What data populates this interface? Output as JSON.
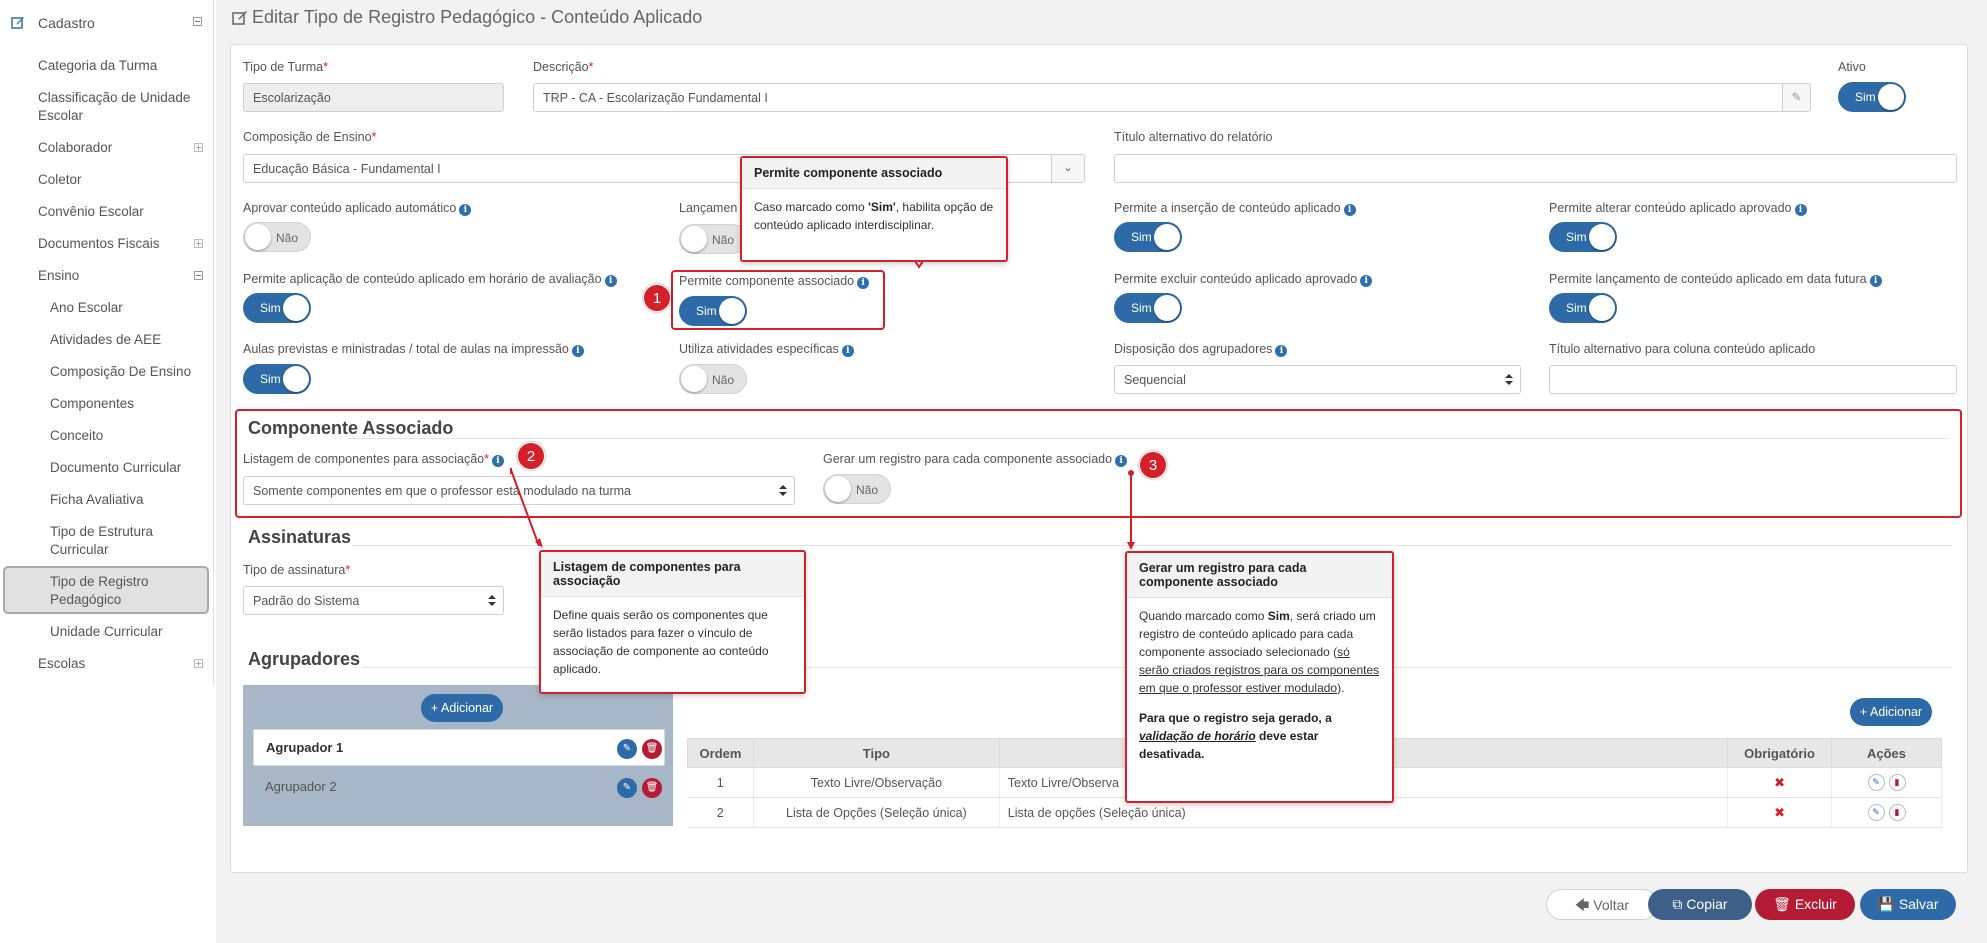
{
  "sidebar": {
    "header": "Cadastro",
    "items": [
      {
        "label": "Categoria da Turma"
      },
      {
        "label": "Classificação de Unidade Escolar"
      },
      {
        "label": "Colaborador"
      },
      {
        "label": "Coletor"
      },
      {
        "label": "Convênio Escolar"
      },
      {
        "label": "Documentos Fiscais"
      },
      {
        "label": "Ensino"
      },
      {
        "label": "Ano Escolar"
      },
      {
        "label": "Atividades de AEE"
      },
      {
        "label": "Composição De Ensino"
      },
      {
        "label": "Componentes"
      },
      {
        "label": "Conceito"
      },
      {
        "label": "Documento Curricular"
      },
      {
        "label": "Ficha Avaliativa"
      },
      {
        "label": "Tipo de Estrutura Curricular"
      },
      {
        "label": "Tipo de Registro Pedagógico"
      },
      {
        "label": "Unidade Curricular"
      },
      {
        "label": "Escolas"
      }
    ]
  },
  "page": {
    "title": "Editar Tipo de Registro Pedagógico - Conteúdo Aplicado"
  },
  "form": {
    "tipo_turma": {
      "label": "Tipo de Turma",
      "value": "Escolarização"
    },
    "descricao": {
      "label": "Descrição",
      "value": "TRP - CA - Escolarização Fundamental I"
    },
    "ativo": {
      "label": "Ativo",
      "value": "Sim"
    },
    "composicao": {
      "label": "Composição de Ensino",
      "value": "Educação Básica - Fundamental I"
    },
    "titulo_relatorio": {
      "label": "Título alternativo do relatório",
      "value": ""
    },
    "aprovar_auto": {
      "label": "Aprovar conteúdo aplicado automático",
      "value": "Não"
    },
    "lancamento": {
      "label": "Lançamen",
      "value": "Não"
    },
    "permite_insercao": {
      "label": "Permite a inserção de conteúdo aplicado",
      "value": "Sim"
    },
    "permite_alterar": {
      "label": "Permite alterar conteúdo aplicado aprovado",
      "value": "Sim"
    },
    "horario_avaliacao": {
      "label": "Permite aplicação de conteúdo aplicado em horário de avaliação",
      "value": "Sim"
    },
    "componente_associado": {
      "label": "Permite componente associado",
      "value": "Sim"
    },
    "excluir_aprovado": {
      "label": "Permite excluir conteúdo aplicado aprovado",
      "value": "Sim"
    },
    "data_futura": {
      "label": "Permite lançamento de conteúdo aplicado em data futura",
      "value": "Sim"
    },
    "aulas_previstas": {
      "label": "Aulas previstas e ministradas / total de aulas na impressão",
      "value": "Sim"
    },
    "atividades_especificas": {
      "label": "Utiliza atividades específicas",
      "value": "Não"
    },
    "disposicao": {
      "label": "Disposição dos agrupadores",
      "value": "Sequencial"
    },
    "titulo_coluna": {
      "label": "Título alternativo para coluna conteúdo aplicado",
      "value": ""
    }
  },
  "componente_section": {
    "title": "Componente Associado",
    "listagem": {
      "label": "Listagem de componentes para associação",
      "value": "Somente componentes em que o professor está modulado na turma"
    },
    "gerar_registro": {
      "label": "Gerar um registro para cada componente associado",
      "value": "Não"
    }
  },
  "assinaturas": {
    "title": "Assinaturas",
    "tipo": {
      "label": "Tipo de assinatura",
      "value": "Padrão do Sistema"
    }
  },
  "agrupadores": {
    "title": "Agrupadores",
    "add_label": "Adicionar",
    "items": [
      {
        "label": "Agrupador 1"
      },
      {
        "label": "Agrupador 2"
      }
    ],
    "table": {
      "headers": [
        "Ordem",
        "Tipo",
        "",
        "Obrigatório",
        "Ações"
      ],
      "rows": [
        {
          "ordem": "1",
          "tipo": "Texto Livre/Observação",
          "desc": "Texto Livre/Observa"
        },
        {
          "ordem": "2",
          "tipo": "Lista de Opções (Seleção única)",
          "desc": "Lista de opções (Seleção única)"
        }
      ]
    }
  },
  "tooltips": {
    "t1": {
      "title": "Permite componente associado",
      "body_pre": "Caso marcado como ",
      "body_bold": "'Sim'",
      "body_post": ", habilita opção de conteúdo aplicado interdisciplinar."
    },
    "t2": {
      "title": "Listagem de componentes para associação",
      "body": "Define quais serão os componentes que serão listados para fazer o vínculo de associação de componente ao conteúdo aplicado."
    },
    "t3": {
      "title": "Gerar um registro para cada componente associado",
      "p1_pre": "Quando marcado como ",
      "p1_bold": "Sim",
      "p1_mid": ", será criado um registro de conteúdo aplicado para cada componente associado selecionado (",
      "p1_u": "só serão criados registros para os componentes em que o professor estiver modulado",
      "p1_end": ").",
      "p2_pre": "Para que o registro seja gerado, a ",
      "p2_em": "validação de horário",
      "p2_post": " deve estar desativada."
    }
  },
  "badges": [
    "1",
    "2",
    "3"
  ],
  "footer": {
    "voltar": "Voltar",
    "copiar": "Copiar",
    "excluir": "Excluir",
    "salvar": "Salvar"
  },
  "colors": {
    "primary": "#2d6aa7",
    "danger": "#b41b35",
    "highlight": "#d4202a"
  }
}
